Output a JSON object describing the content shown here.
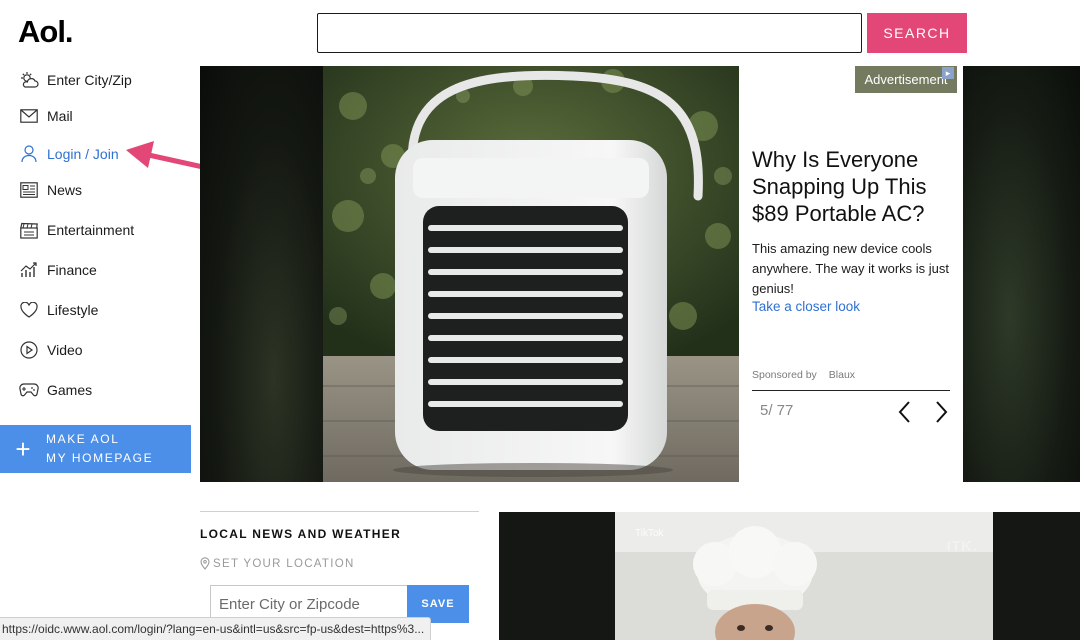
{
  "header": {
    "logo": "Aol.",
    "search": {
      "value": "",
      "placeholder": ""
    },
    "search_button": "SEARCH"
  },
  "sidebar": {
    "items": [
      {
        "label": "Enter City/Zip",
        "icon": "weather-icon"
      },
      {
        "label": "Mail",
        "icon": "mail-icon"
      },
      {
        "label": "Login / Join",
        "icon": "user-icon"
      },
      {
        "label": "News",
        "icon": "news-icon"
      },
      {
        "label": "Entertainment",
        "icon": "clapperboard-icon"
      },
      {
        "label": "Finance",
        "icon": "finance-chart-icon"
      },
      {
        "label": "Lifestyle",
        "icon": "heart-icon"
      },
      {
        "label": "Video",
        "icon": "play-icon"
      },
      {
        "label": "Games",
        "icon": "gamepad-icon"
      }
    ],
    "homepage_button": {
      "line1": "MAKE AOL",
      "line2": "MY HOMEPAGE"
    }
  },
  "hero_ad": {
    "tag": "Advertisement",
    "headline": "Why Is Everyone Snapping Up This $89 Portable AC?",
    "blurb": "This amazing new device cools anywhere. The way it works is just genius!",
    "cta": "Take a closer look",
    "sponsored_label": "Sponsored by",
    "sponsor": "Blaux",
    "counter": "5/ 77"
  },
  "local_news": {
    "title": "LOCAL NEWS AND WEATHER",
    "set_location": "SET YOUR LOCATION",
    "zip_placeholder": "Enter City or Zipcode",
    "save_button": "SAVE"
  },
  "video_tile": {
    "watermark": "ITK.",
    "tiktok_mark": "TikTok"
  },
  "status_bar": {
    "url": "https://oidc.www.aol.com/login/?lang=en-us&intl=us&src=fp-us&dest=https%3..."
  },
  "colors": {
    "search_button": "#e24777",
    "accent_blue": "#4c8fe8",
    "link_blue": "#2f70d3",
    "annotation_arrow": "#e24777"
  }
}
